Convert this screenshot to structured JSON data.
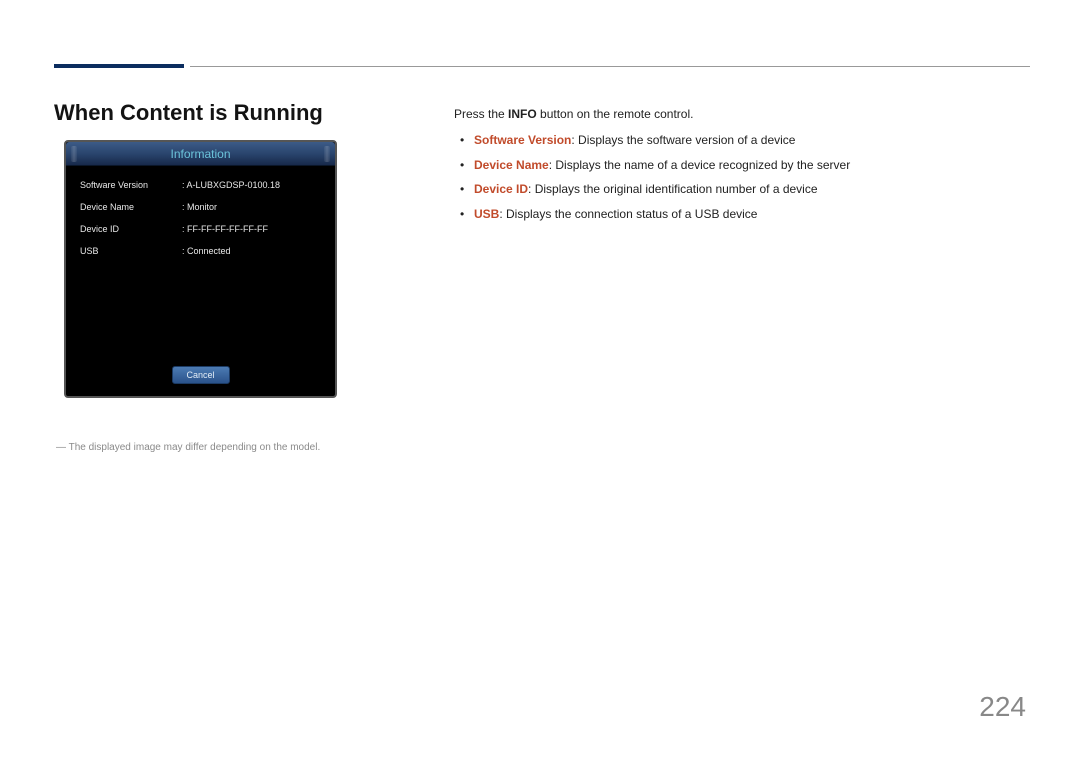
{
  "heading": "When Content is Running",
  "dialog": {
    "title": "Information",
    "rows": [
      {
        "label": "Software Version",
        "value": ": A-LUBXGDSP-0100.18"
      },
      {
        "label": "Device Name",
        "value": ": Monitor"
      },
      {
        "label": "Device ID",
        "value": ": FF-FF-FF-FF-FF-FF"
      },
      {
        "label": "USB",
        "value": ": Connected"
      }
    ],
    "cancel": "Cancel"
  },
  "footnote": "―   The displayed image may differ depending on the model.",
  "intro": {
    "pre": "Press the ",
    "bold": "INFO",
    "post": " button on the remote control."
  },
  "bullets": [
    {
      "term": "Software Version",
      "desc": ": Displays the software version of a device"
    },
    {
      "term": "Device Name",
      "desc": ": Displays the name of a device recognized by the server"
    },
    {
      "term": "Device ID",
      "desc": ": Displays the original identification number of a device"
    },
    {
      "term": "USB",
      "desc": ": Displays the connection status of a USB device"
    }
  ],
  "pageNumber": "224"
}
